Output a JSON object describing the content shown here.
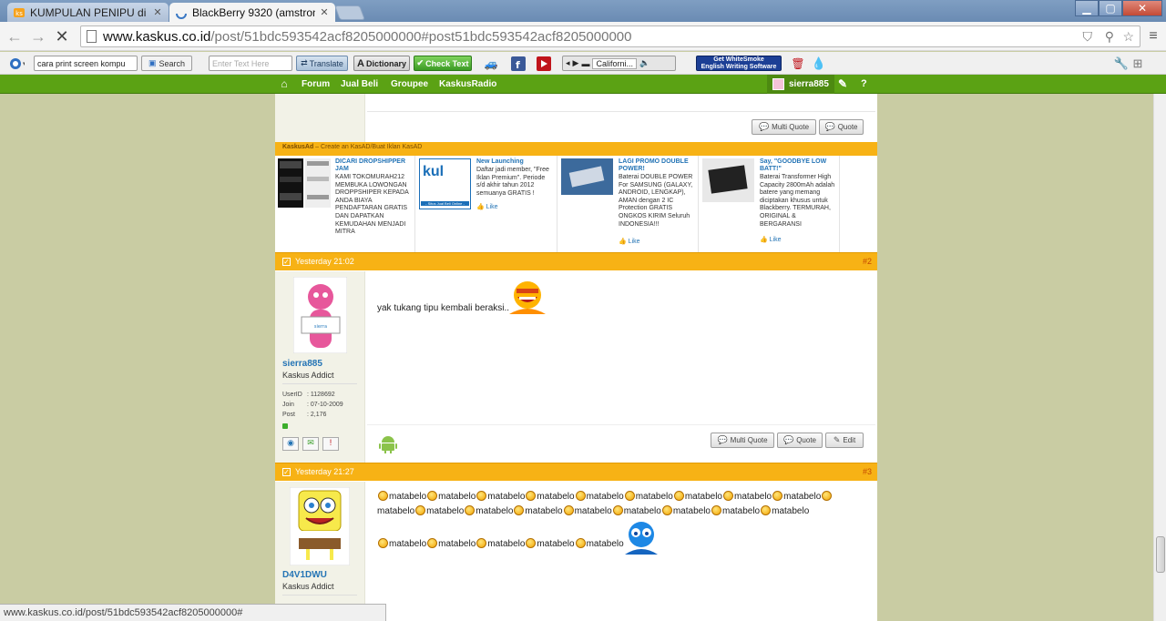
{
  "browser": {
    "tabs": [
      {
        "label": "KUMPULAN PENIPU di fjb",
        "active": false
      },
      {
        "label": "BlackBerry 9320 (amstrong",
        "active": true
      }
    ],
    "url_host": "www.kaskus.co.id",
    "url_path": "/post/51bdc593542acf8205000000#post51bdc593542acf8205000000",
    "status_url": "www.kaskus.co.id/post/51bdc593542acf8205000000#"
  },
  "toolbar": {
    "search_value": "cara print screen kompu",
    "search_label": "Search",
    "text_placeholder": "Enter Text Here",
    "translate_label": "Translate",
    "dictionary_label": "Dictionary",
    "check_label": "Check Text",
    "media_track": "Californi...",
    "whitesmoke_line1": "Get WhiteSmoke",
    "whitesmoke_line2": "English Writing Software"
  },
  "site_nav": {
    "items": [
      "Forum",
      "Jual Beli",
      "Groupee",
      "KaskusRadio"
    ],
    "username": "sierra885"
  },
  "top_post": {
    "multi_quote": "Multi Quote",
    "quote": "Quote"
  },
  "ads": {
    "header_brand": "KaskusAd",
    "header_rest": " – Create an KasAD/Buat Iklan KasAD",
    "items": [
      {
        "title": "DICARI DROPSHIPPER JAM",
        "body": "KAMI TOKOMURAH212 MEMBUKA LOWONGAN DROPPSHIPER KEPADA ANDA BIAYA PENDAFTARAN GRATIS DAN DAPATKAN KEMUDAHAN MENJADI MITRA",
        "like": ""
      },
      {
        "title": "New Launching",
        "body": "Daftar jadi member, \"Free Iklan Premium\". Periode s/d akhir tahun 2012 semuanya GRATIS !",
        "like": "Like",
        "logo_text": "kul",
        "logo_sub": "- Situs Jual Beli Online -"
      },
      {
        "title": "LAGI PROMO DOUBLE POWER!",
        "body": "Baterai DOUBLE POWER For SAMSUNG (GALAXY, ANDROID, LENGKAP), AMAN dengan 2 IC Protection GRATIS ONGKOS KIRIM Seluruh INDONESIA!!!",
        "like": "Like"
      },
      {
        "title": "Say, \"GOODBYE LOW BATT!\"",
        "body": "Baterai Transformer High Capacity 2800mAh adalah batere yang memang diciptakan khusus untuk Blackberry. TERMURAH, ORIGINAL & BERGARANSI",
        "like": "Like"
      }
    ]
  },
  "posts": [
    {
      "date": "Yesterday 21:02",
      "number": "#2",
      "username": "sierra885",
      "rank": "Kaskus Addict",
      "info": [
        {
          "k": "UserID",
          "v": ": 1128692"
        },
        {
          "k": "Join",
          "v": ": 07-10-2009"
        },
        {
          "k": "Post",
          "v": ": 2,176"
        }
      ],
      "message": "yak tukang tipu kembali beraksi..",
      "buttons": {
        "multi_quote": "Multi Quote",
        "quote": "Quote",
        "edit": "Edit"
      }
    },
    {
      "date": "Yesterday 21:27",
      "number": "#3",
      "username": "D4V1DWU",
      "rank": "Kaskus Addict",
      "word": "matabelo"
    }
  ],
  "colors": {
    "site_green": "#5ba214",
    "post_bar": "#f7b215",
    "link_blue": "#2474b5",
    "page_bg": "#c9cca3"
  }
}
